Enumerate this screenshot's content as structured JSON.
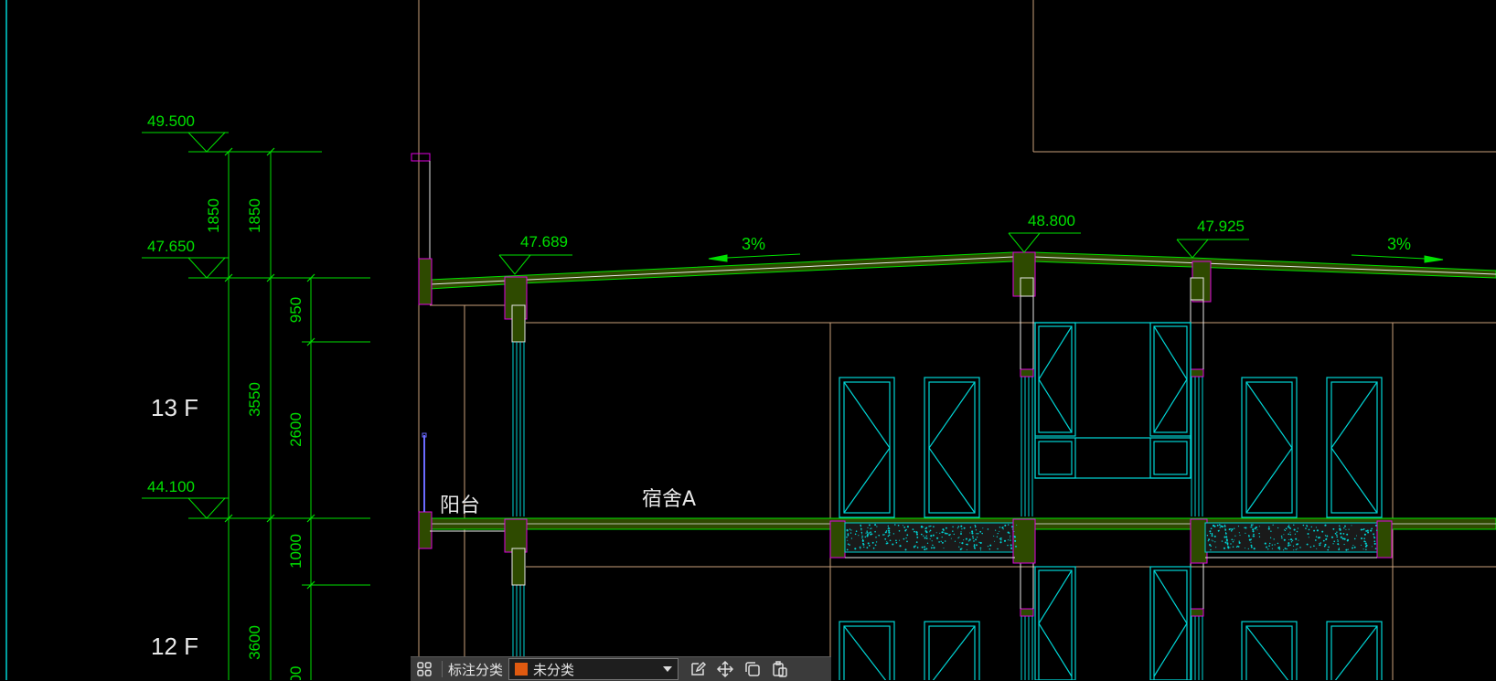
{
  "drawing": {
    "elevations": {
      "roof_top": "49.500",
      "parapet": "47.650",
      "floor13": "44.100",
      "left_roof": "47.689",
      "ridge": "48.800",
      "right_roof": "47.925"
    },
    "dimensions": {
      "d1850a": "1850",
      "d1850b": "1850",
      "d3550": "3550",
      "d950": "950",
      "d2600": "2600",
      "d1000": "1000",
      "d3600": "3600",
      "d_partial": "00"
    },
    "floors": {
      "f13": "13 F",
      "f12": "12 F"
    },
    "rooms": {
      "balcony": "阳台",
      "dorm": "宿舍A"
    },
    "slopes": {
      "left": "3%",
      "right": "3%"
    },
    "colors": {
      "green": "#00e000",
      "cyan": "#00d4d4",
      "tan": "#c8a07a",
      "magenta": "#e000e0",
      "fill": "#2e4a00"
    }
  },
  "toolbar": {
    "grid_icon": "grid-icon",
    "label": "标注分类",
    "category": {
      "value": "未分类",
      "color": "#e05a10"
    },
    "tools": [
      "edit-icon",
      "move-icon",
      "copy-icon",
      "paste-icon"
    ]
  }
}
